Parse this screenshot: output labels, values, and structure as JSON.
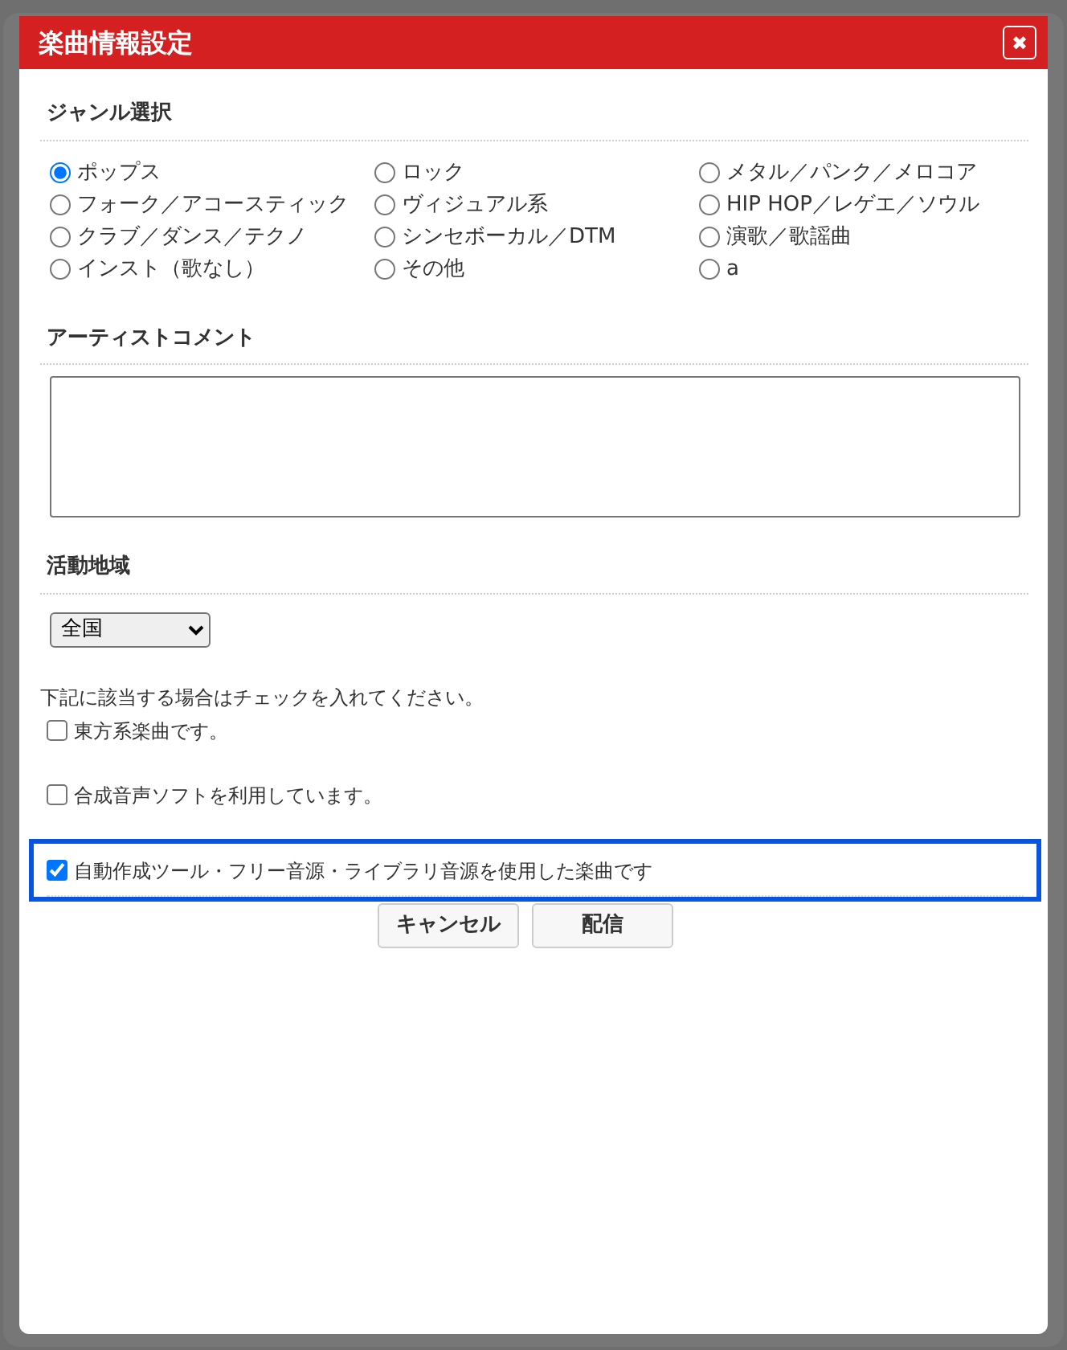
{
  "dialog": {
    "title": "楽曲情報設定",
    "close_icon": "✖"
  },
  "genre": {
    "heading": "ジャンル選択",
    "options": [
      {
        "label": "ポップス",
        "selected": true
      },
      {
        "label": "ロック",
        "selected": false
      },
      {
        "label": "メタル／パンク／メロコア",
        "selected": false
      },
      {
        "label": "フォーク／アコースティック",
        "selected": false
      },
      {
        "label": "ヴィジュアル系",
        "selected": false
      },
      {
        "label": "HIP HOP／レゲエ／ソウル",
        "selected": false
      },
      {
        "label": "クラブ／ダンス／テクノ",
        "selected": false
      },
      {
        "label": "シンセボーカル／DTM",
        "selected": false
      },
      {
        "label": "演歌／歌謡曲",
        "selected": false
      },
      {
        "label": "インスト（歌なし）",
        "selected": false
      },
      {
        "label": "その他",
        "selected": false
      },
      {
        "label": "a",
        "selected": false
      }
    ]
  },
  "artist_comment": {
    "heading": "アーティストコメント"
  },
  "region": {
    "heading": "活動地域",
    "value": "全国"
  },
  "notice": "下記に該当する場合はチェックを入れてください。",
  "checks": [
    {
      "label": "東方系楽曲です。",
      "checked": false,
      "highlighted": false
    },
    {
      "label": "合成音声ソフトを利用しています。",
      "checked": false,
      "highlighted": false
    },
    {
      "label": "自動作成ツール・フリー音源・ライブラリ音源を使用した楽曲です",
      "checked": true,
      "highlighted": true
    }
  ],
  "buttons": [
    "キャンセル",
    "配信"
  ]
}
